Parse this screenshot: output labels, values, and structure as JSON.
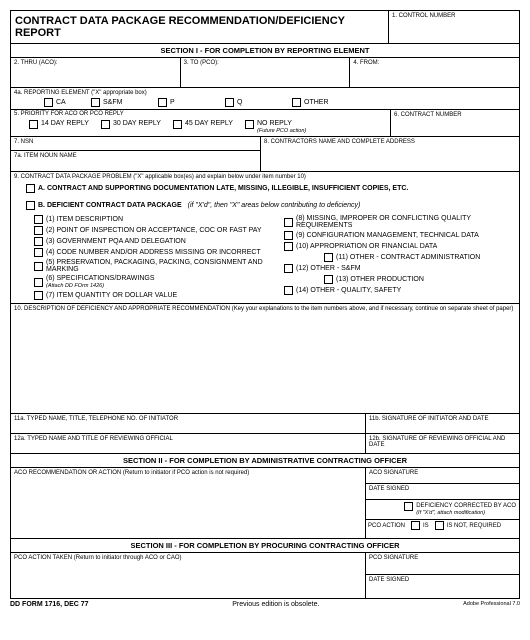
{
  "title": "CONTRACT DATA PACKAGE RECOMMENDATION/DEFICIENCY REPORT",
  "f1": "1.  CONTROL NUMBER",
  "sec1": "SECTION I - FOR COMPLETION BY REPORTING ELEMENT",
  "f2": "2.  THRU (ACO):",
  "f3": "3.  TO (PCO):",
  "f4": "4.  FROM:",
  "f4a": "4a.  REPORTING ELEMENT (\"X\" appropriate box)",
  "opt_ca": "CA",
  "opt_sfm": "S&FM",
  "opt_p": "P",
  "opt_q": "Q",
  "opt_other": "OTHER",
  "f5": "5.  PRIORITY FOR ACO OR PCO REPLY",
  "f6": "6.  CONTRACT NUMBER",
  "opt_14": "14 DAY REPLY",
  "opt_30": "30 DAY REPLY",
  "opt_45": "45 DAY REPLY",
  "opt_no": "NO REPLY",
  "opt_no_sub": "(Future PCO action)",
  "f7": "7.  NSN",
  "f8": "8.  CONTRACTORS NAME AND COMPLETE ADDRESS",
  "f7a": "7a.  ITEM NOUN NAME",
  "f9": "9.  CONTRACT DATA PACKAGE PROBLEM (\"X\" applicable box(es) and explain below under item number 10)",
  "f9a": "A.  CONTRACT AND SUPPORTING DOCUMENTATION LATE, MISSING, ILLEGIBLE, INSUFFICIENT COPIES, ETC.",
  "f9b": "B.  DEFICIENT CONTRACT DATA PACKAGE",
  "f9b_hint": "(if \"X'd\", then \"X\" areas below contributing to deficiency)",
  "d1": "(1) ITEM DESCRIPTION",
  "d2": "(2) POINT OF INSPECTION OR ACCEPTANCE, COC OR FAST PAY",
  "d3": "(3) GOVERNMENT PQA AND DELEGATION",
  "d4": "(4) CODE NUMBER AND/OR ADDRESS MISSING OR INCORRECT",
  "d5": "(5) PRESERVATION, PACKAGING, PACKING, CONSIGNMENT AND MARKING",
  "d6": "(6) SPECIFICATIONS/DRAWINGS",
  "d6_sub": "(Attach DD FOrm 1426)",
  "d7": "(7) ITEM QUANTITY OR DOLLAR VALUE",
  "d8": "(8) MISSING, IMPROPER OR CONFLICTING QUALITY REQUIREMENTS",
  "d9": "(9) CONFIGURATION MANAGEMENT, TECHNICAL DATA",
  "d10": "(10) APPROPRIATION OR FINANCIAL DATA",
  "d11": "(11) OTHER - CONTRACT ADMINISTRATION",
  "d12": "(12) OTHER - S&FM",
  "d13": "(13) OTHER   PRODUCTION",
  "d14": "(14) OTHER - QUALITY, SAFETY",
  "f10": "10.  DESCRIPTION OF DEFICIENCY AND APPROPRIATE RECOMMENDATION (Key your explanations to the item numbers above, and if necessary, continue on separate sheet of paper)",
  "f11a": "11a.  TYPED NAME, TITLE, TELEPHONE NO. OF INITIATOR",
  "f11b": "11b.  SIGNATURE OF INITIATOR AND DATE",
  "f12a": "12a.  TYPED NAME AND TITLE OF REVIEWING OFFICIAL",
  "f12b": "12b.  SIGNATURE OF REVIEWING OFFICIAL AND DATE",
  "sec2": "SECTION II - FOR COMPLETION BY ADMINISTRATIVE CONTRACTING OFFICER",
  "aco_rec": "ACO RECOMMENDATION OR ACTION (Return to initiator if PCO action is not required)",
  "aco_sig": "ACO SIGNATURE",
  "date_signed": "DATE SIGNED",
  "def_corr": "DEFICIENCY CORRECTED BY ACO",
  "def_corr_sub": "(If \"X'd\", attach modification)",
  "pco_action": "PCO ACTION",
  "pco_is": "IS",
  "pco_isnot": "IS NOT, REQUIRED",
  "sec3": "SECTION III - FOR COMPLETION BY PROCURING CONTRACTING OFFICER",
  "pco_taken": "PCO ACTION TAKEN (Return to initiator through ACO or CAO)",
  "pco_sig": "PCO SIGNATURE",
  "foot_left": "DD FORM 1716, DEC 77",
  "foot_center": "Previous edition is obsolete.",
  "foot_right": "Adobe Professional 7.0"
}
